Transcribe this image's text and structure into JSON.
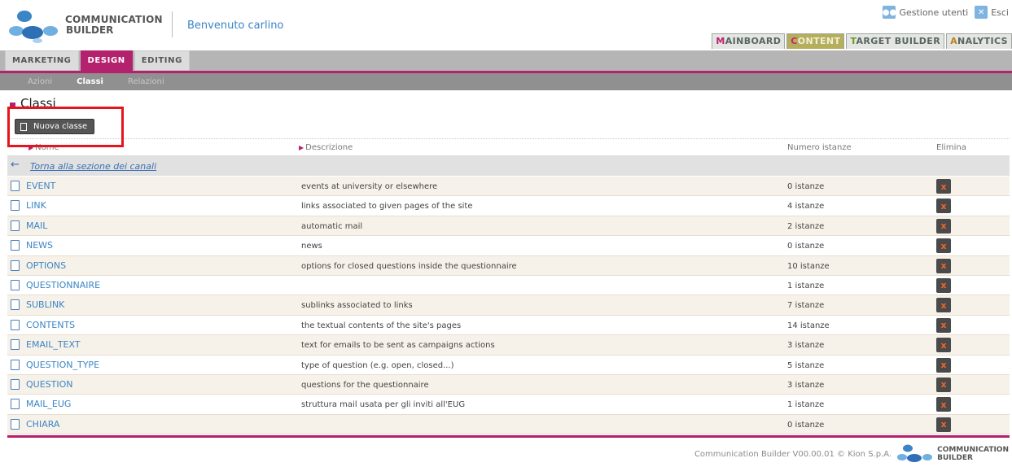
{
  "app": {
    "logo_line1": "COMMUNICATION",
    "logo_line2": "BUILDER",
    "welcome": "Benvenuto carlino"
  },
  "topright": {
    "users_label": "Gestione utenti",
    "exit_label": "Esci"
  },
  "main_tabs": [
    {
      "first": "M",
      "rest": "AINBOARD"
    },
    {
      "first": "C",
      "rest": "ONTENT"
    },
    {
      "first": "T",
      "rest": "ARGET BUILDER"
    },
    {
      "first": "A",
      "rest": "NALYTICS"
    }
  ],
  "nav2": [
    "MARKETING",
    "DESIGN",
    "EDITING"
  ],
  "nav3": [
    "Azioni",
    "Classi",
    "Relazioni"
  ],
  "page_title": "Classi",
  "new_button": "Nuova classe",
  "table": {
    "headers": {
      "name": "Nome",
      "desc": "Descrizione",
      "count": "Numero istanze",
      "delete": "Elimina"
    },
    "back_link": "Torna alla sezione dei canali",
    "rows": [
      {
        "name": "EVENT",
        "desc": "events at university or elsewhere",
        "count": "0 istanze"
      },
      {
        "name": "LINK",
        "desc": "links associated to given pages of the site",
        "count": "4 istanze"
      },
      {
        "name": "MAIL",
        "desc": "automatic mail",
        "count": "2 istanze"
      },
      {
        "name": "NEWS",
        "desc": "news",
        "count": "0 istanze"
      },
      {
        "name": "OPTIONS",
        "desc": "options for closed questions inside the questionnaire",
        "count": "10 istanze"
      },
      {
        "name": "QUESTIONNAIRE",
        "desc": "",
        "count": "1 istanze"
      },
      {
        "name": "SUBLINK",
        "desc": "sublinks associated to links",
        "count": "7 istanze"
      },
      {
        "name": "CONTENTS",
        "desc": "the textual contents of the site's pages",
        "count": "14 istanze"
      },
      {
        "name": "EMAIL_TEXT",
        "desc": "text for emails to be sent as campaigns actions",
        "count": "3 istanze"
      },
      {
        "name": "QUESTION_TYPE",
        "desc": "type of question (e.g. open, closed...)",
        "count": "5 istanze"
      },
      {
        "name": "QUESTION",
        "desc": "questions for the questionnaire",
        "count": "3 istanze"
      },
      {
        "name": "MAIL_EUG",
        "desc": "struttura mail usata per gli inviti all'EUG",
        "count": "1 istanze"
      },
      {
        "name": "CHIARA",
        "desc": "",
        "count": "0 istanze"
      }
    ],
    "delete_glyph": "x"
  },
  "footer": {
    "text": "Communication Builder V00.00.01 © Kion S.p.A.",
    "logo_line1": "COMMUNICATION",
    "logo_line2": "BUILDER"
  },
  "colors": {
    "accent": "#b4216d",
    "link": "#3a85c5",
    "highlight": "#e6141e"
  }
}
